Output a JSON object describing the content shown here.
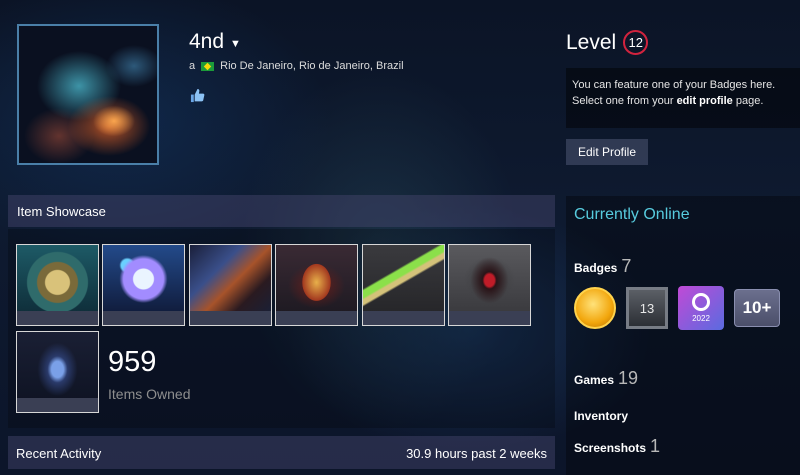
{
  "profile": {
    "persona_name": "4nd",
    "real_name": "a",
    "location": "Rio De Janeiro, Rio de Janeiro, Brazil"
  },
  "level": {
    "label": "Level",
    "value": "12"
  },
  "badge_note": {
    "line1": "You can feature one of your Badges here.",
    "line2_prefix": "Select one from your ",
    "line2_link": "edit profile",
    "line2_suffix": " page."
  },
  "edit_profile": "Edit Profile",
  "status": {
    "online": "Currently Online"
  },
  "stats": {
    "badges_label": "Badges",
    "badges_count": "7",
    "badges_more": "10+",
    "badge_year": "2022",
    "badge_13": "13",
    "games_label": "Games",
    "games_count": "19",
    "inventory_label": "Inventory",
    "screenshots_label": "Screenshots",
    "screenshots_count": "1"
  },
  "showcase": {
    "title": "Item Showcase",
    "items_count": "959",
    "items_label": "Items Owned"
  },
  "recent": {
    "title": "Recent Activity",
    "hours": "30.9 hours past 2 weeks"
  },
  "colors": {
    "accent_online": "#57cbde",
    "level_ring": "#d1233e",
    "panel_header": "#3a3a5c"
  }
}
